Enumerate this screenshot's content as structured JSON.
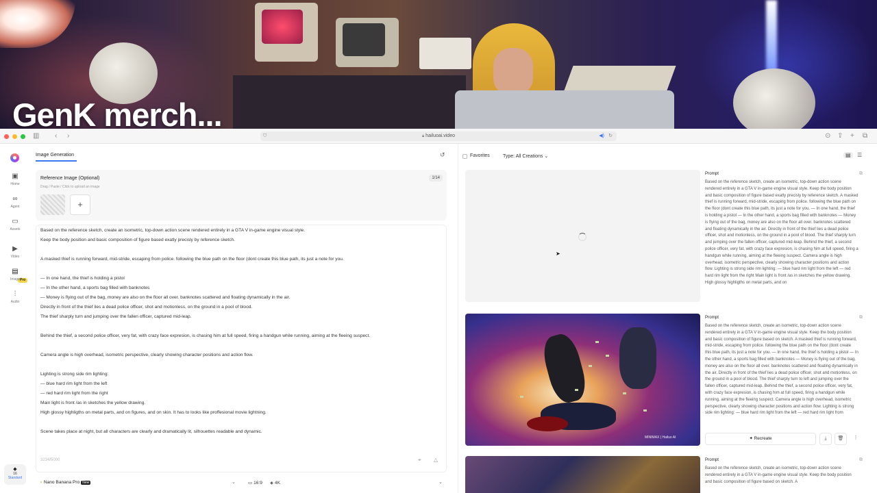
{
  "video": {
    "caption": "GenK merch..."
  },
  "browser": {
    "url": "hailuoai.video"
  },
  "sidebar": {
    "items": [
      {
        "label": "Home",
        "icon": "home-icon"
      },
      {
        "label": "Agent",
        "icon": "agent-icon"
      },
      {
        "label": "Assets",
        "icon": "folder-icon"
      },
      {
        "label": "Video",
        "icon": "video-icon"
      },
      {
        "label": "Image",
        "icon": "image-icon"
      },
      {
        "label": "Audio",
        "icon": "audio-icon"
      }
    ],
    "pro_badge": "Pro",
    "plan": {
      "count": "16",
      "label": "Standard"
    }
  },
  "left": {
    "tab": "Image Generation",
    "reference": {
      "title": "Reference Image (Optional)",
      "subtitle": "Drag / Paste / Click to upload an image",
      "count": "1/14"
    },
    "prompt_lines": [
      "Based on the reference sketch, create an isometric, top-down action scene rendered entirely in a GTA V in-game engine visual style.",
      "Keep the body position and basic composition of figure based exatly precisly by reference sketch.",
      "",
      "A masked thief is running forward, mid-stride, escaping from police. following the blue path on the floor (dont create this blue path, its just a note for you.",
      "",
      "— In one hand, the thief is holding a pistol",
      "— In the other hand, a sports bag filled with banknotes",
      "— Money is flying out of the bag, money are also on the floor all over. banknotes scattered and floating dynamically in the air.",
      "Directly in front of the thief lies a dead police officer, shot and motionless, on the ground in a pool of blood.",
      "The thief sharply turn and jumping over the fallen officer, captured mid-leap.",
      "",
      "Behind the thief, a second police officer, very fat, with crazy face expresion, is chasing him at full speed, firing a handgun while running, aiming at the fleeing suspect.",
      "",
      "Camera angle is high overhead, isometric perspective, clearly showing character positions and action flow.",
      "",
      "Lighting is strong side rim lighting:",
      "— blue hard rim light from the left",
      "— red hard rim light from the right",
      "Main light is front /as in  sketches the yellow drawing.",
      "High glossy highligths on metal parts, and on figures, and on skin. It has to looks like proffesional movie lightning.",
      "",
      "Scene takes place at night, but all characters are clearly and dramatically lit, silhouettes readable and dynamic."
    ],
    "char_count": "3234/5000",
    "model": "Nano Banana Pro",
    "model_badge": "New",
    "ratio": "16:9",
    "resolution": "4K"
  },
  "right": {
    "favorites": "Favorites",
    "type_label": "Type:",
    "type_value": "All Creations",
    "cards": [
      {
        "prompt_title": "Prompt",
        "prompt": "Based on the reference sketch, create an isometric, top-down action scene rendered entirely in a GTA V in-game engine visual style. Keep the body position and basic composition of figure based exatly precisly by reference sketch. A masked thief is running forward, mid-stride, escaping from police. following the blue path on the floor (dont create this blue path, its just a note for you. — In one hand, the thief is holding a pistol — In the other hand, a sports bag filled with banknotes — Money is flying out of the bag, money are also on the floor all over. banknotes scattered and floating dynamically in the air. Directly in front of the thief lies a dead police officer, shot and motionless, on the ground in a pool of blood. The thief sharply turn and jumping over the fallen officer, captured mid-leap. Behind the thief, a second police officer, very fat, with crazy face expresion, is chasing him at full speed, firing a handgun while running, aiming at the fleeing suspect. Camera angle is high overhead, isometric perspective, clearly showing character positions and action flow. Lighting is strong side rim lighting: — blue hard rim light from the left — red hard rim light from the right Main light is front /as in sketches the yellow drawing. High glossy highligths on metal parts, and on"
      },
      {
        "prompt_title": "Prompt",
        "prompt": "Based on the reference sketch, create an isometric, top-down action scene rendered entirely in a GTA V in-game engine visual style. Keep the body position and basic composition of figure based on sketch. A masked thief is running forward, mid-stride, escaping from police. following the blue path on the floor (dont create this blue path, its just a note for you. — In one hand, the thief is holding a pistol — In the other hand, a sports bag filled with banknotes — Money is flying out of the bag, money are also on the floor all over. banknotes scattered and floating dynamically in the air. Directly in front of the thief lies a dead police officer, shot and motionless, on the ground in a pool of blood. The thief sharply turn to left and jumping over the fallen officer, captured mid-leap. Behind the thief, a second police officer, very fat, with crazy face expresion, is chasing him at full speed, firing a handgun while running, aiming at the fleeing suspect. Camera angle is high overhead, isometric perspective, clearly showing character positions and action flow. Lighting is strong side rim lighting: — blue hard rim light from the left — red hard rim light from",
        "watermark": "MINIMAX | Hailuo AI",
        "recreate": "Recreate"
      },
      {
        "prompt_title": "Prompt",
        "prompt": "Based on the reference sketch, create an isometric, top-down action scene rendered entirely in a GTA V in-game engine visual style. Keep the body position and basic composition of figure based on sketch. A"
      }
    ]
  }
}
